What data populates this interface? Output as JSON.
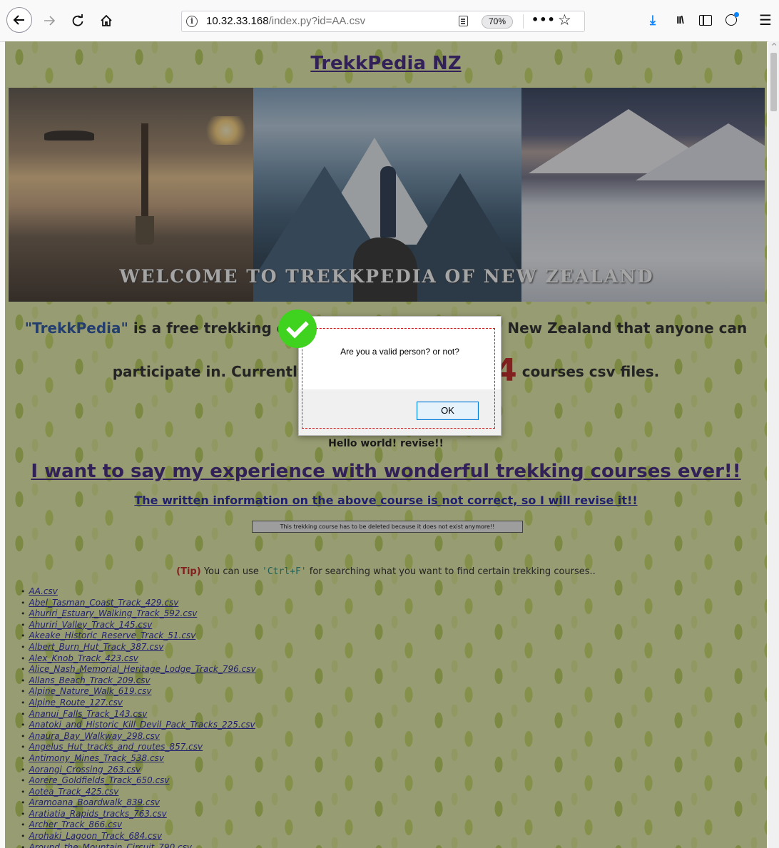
{
  "browser": {
    "url_host": "10.32.33.168",
    "url_path": "/index.py?id=AA.csv",
    "zoom": "70%",
    "icons": [
      "back-icon",
      "forward-icon",
      "reload-icon",
      "home-icon",
      "info-icon",
      "reader-view-icon",
      "more-icon",
      "bookmark-star-icon",
      "download-icon",
      "library-icon",
      "sidebar-icon",
      "account-icon",
      "menu-icon"
    ]
  },
  "page": {
    "title": "TrekkPedia NZ",
    "banner_caption": "WELCOME TO TREKKPEDIA OF NEW ZEALAND",
    "intro_brand": "\"TrekkPedia\"",
    "intro_line1_rest": " is a free trekking course encyclopedia around New Zealand that anyone can",
    "intro_line2_start": "participate in. Currently, Our website has",
    "intro_count": "944",
    "intro_line2_end": " courses csv files.",
    "current_file": "AA.csv",
    "content_text": "Hello world! revise!!",
    "experience_link": "I want to say my experience with wonderful trekking courses ever!!",
    "revise_link": "The written information on the above course is not correct, so I will revise it!!",
    "delete_button": "This trekking course has to be deleted because it does not exist anymore!!",
    "tip_tag": "(Tip)",
    "tip_pre": " You can use ",
    "tip_key": "'Ctrl+F'",
    "tip_post": " for searching what you want to find certain trekking courses.."
  },
  "files": [
    "AA.csv",
    "Abel_Tasman_Coast_Track_429.csv",
    "Ahuriri_Estuary_Walking_Track_592.csv",
    "Ahuriri_Valley_Track_145.csv",
    "Akeake_Historic_Reserve_Track_51.csv",
    "Albert_Burn_Hut_Track_387.csv",
    "Alex_Knob_Track_423.csv",
    "Alice_Nash_Memorial_Heritage_Lodge_Track_796.csv",
    "Allans_Beach_Track_209.csv",
    "Alpine_Nature_Walk_619.csv",
    "Alpine_Route_127.csv",
    "Ananui_Falls_Track_143.csv",
    "Anatoki_and_Historic_Kill_Devil_Pack_Tracks_225.csv",
    "Anaura_Bay_Walkway_298.csv",
    "Angelus_Hut_tracks_and_routes_857.csv",
    "Antimony_Mines_Track_538.csv",
    "Aorangi_Crossing_263.csv",
    "Aorere_Goldfields_Track_650.csv",
    "Aotea_Track_425.csv",
    "Aramoana_Boardwalk_839.csv",
    "Aratiatia_Rapids_tracks_763.csv",
    "Archer_Track_866.csv",
    "Arohaki_Lagoon_Track_684.csv",
    "Around_the_Mountain_Circuit_790.csv"
  ],
  "dialog": {
    "message": "Are you a valid person? or not?",
    "ok_label": "OK"
  },
  "colors": {
    "title_link": "#3a1a7a",
    "brand": "#1f4fa1",
    "count": "#c41b1b",
    "focus_outline": "#d11a1a",
    "check_badge": "#3fd21f"
  }
}
